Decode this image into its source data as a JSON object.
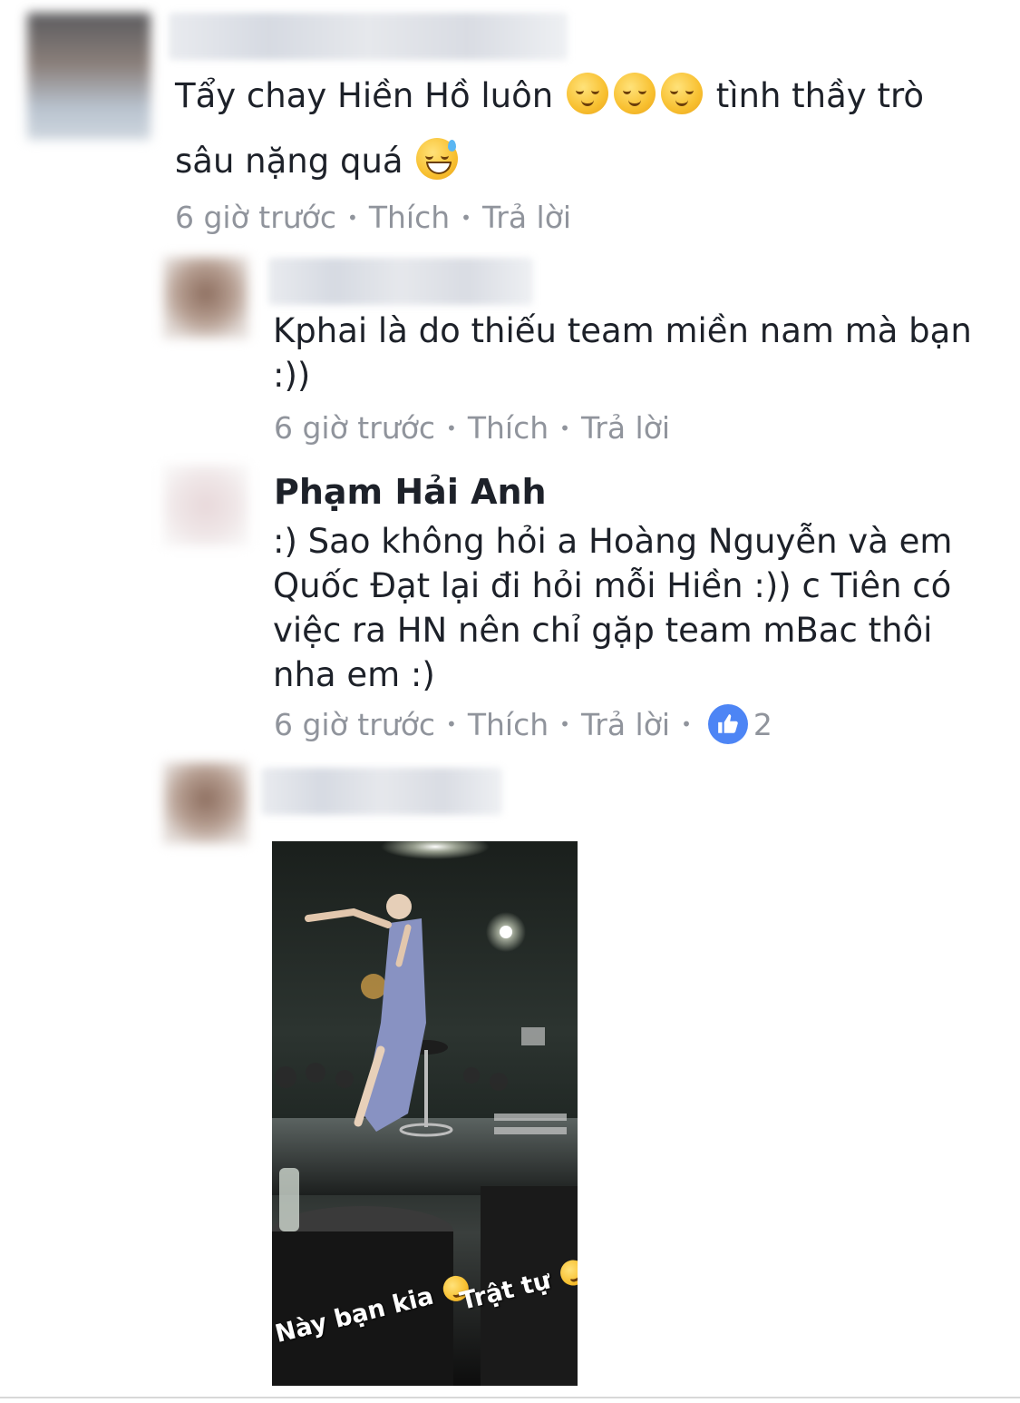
{
  "comments": [
    {
      "text_line1": "Tẩy chay Hiền Hồ luôn",
      "text_line1_end": "tình thầy trò",
      "text_line2": "sâu nặng quá",
      "time": "6 giờ trước",
      "like": "Thích",
      "reply": "Trả lời"
    },
    {
      "text_line1": "Kphai là do thiếu team miền nam mà bạn",
      "text_line2": ":))",
      "time": "6 giờ trước",
      "like": "Thích",
      "reply": "Trả lời"
    },
    {
      "author": "Phạm Hải Anh",
      "lines": [
        ":) Sao không hỏi a Hoàng Nguyễn và em",
        "Quốc Đạt lại đi hỏi mỗi Hiền :)) c Tiên có",
        "việc ra HN nên chỉ gặp team mBac thôi",
        "nha em :)"
      ],
      "time": "6 giờ trước",
      "like": "Thích",
      "reply": "Trả lời",
      "like_count": "2"
    }
  ],
  "photo": {
    "caption_left": "Này bạn kia",
    "caption_right": "Trật tự"
  },
  "icons": {
    "emoji": "relieved-face-icon",
    "emoji_grin": "grinning-sweat-icon",
    "like": "thumbs-up-icon"
  },
  "colors": {
    "meta_text": "#90949c",
    "like_blue": "#4d85f5"
  }
}
